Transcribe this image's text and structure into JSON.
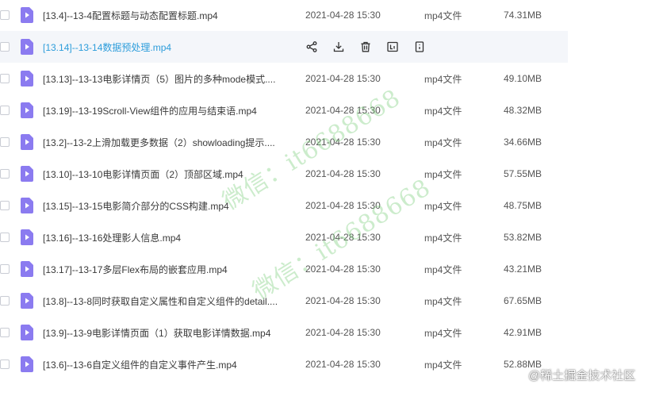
{
  "files": [
    {
      "name": "[13.4]--13-4配置标题与动态配置标题.mp4",
      "date": "2021-04-28 15:30",
      "type": "mp4文件",
      "size": "74.31MB"
    },
    {
      "name": "[13.14]--13-14数据预处理.mp4",
      "date": "",
      "type": "",
      "size": ""
    },
    {
      "name": "[13.13]--13-13电影详情页（5）图片的多种mode模式....",
      "date": "2021-04-28 15:30",
      "type": "mp4文件",
      "size": "49.10MB"
    },
    {
      "name": "[13.19]--13-19Scroll-View组件的应用与结束语.mp4",
      "date": "2021-04-28 15:30",
      "type": "mp4文件",
      "size": "48.32MB"
    },
    {
      "name": "[13.2]--13-2上滑加载更多数据（2）showloading提示....",
      "date": "2021-04-28 15:30",
      "type": "mp4文件",
      "size": "34.66MB"
    },
    {
      "name": "[13.10]--13-10电影详情页面（2）顶部区域.mp4",
      "date": "2021-04-28 15:30",
      "type": "mp4文件",
      "size": "57.55MB"
    },
    {
      "name": "[13.15]--13-15电影简介部分的CSS构建.mp4",
      "date": "2021-04-28 15:30",
      "type": "mp4文件",
      "size": "48.75MB"
    },
    {
      "name": "[13.16]--13-16处理影人信息.mp4",
      "date": "2021-04-28 15:30",
      "type": "mp4文件",
      "size": "53.82MB"
    },
    {
      "name": "[13.17]--13-17多层Flex布局的嵌套应用.mp4",
      "date": "2021-04-28 15:30",
      "type": "mp4文件",
      "size": "43.21MB"
    },
    {
      "name": "[13.8]--13-8同时获取自定义属性和自定义组件的detail....",
      "date": "2021-04-28 15:30",
      "type": "mp4文件",
      "size": "67.65MB"
    },
    {
      "name": "[13.9]--13-9电影详情页面（1）获取电影详情数据.mp4",
      "date": "2021-04-28 15:30",
      "type": "mp4文件",
      "size": "42.91MB"
    },
    {
      "name": "[13.6]--13-6自定义组件的自定义事件产生.mp4",
      "date": "2021-04-28 15:30",
      "type": "mp4文件",
      "size": "52.88MB"
    }
  ],
  "hover_actions": [
    "share-icon",
    "download-icon",
    "delete-icon",
    "rename-icon",
    "more-icon"
  ],
  "watermark": {
    "line1": "微信：it6688668",
    "line2": "微信：it6688668"
  },
  "badge": "@稀土掘金技术社区",
  "colors": {
    "accent": "#2d9ddb",
    "file_icon": "#8b7bf0",
    "hover_row": "#f4f6fa",
    "watermark": "#78cd78"
  }
}
